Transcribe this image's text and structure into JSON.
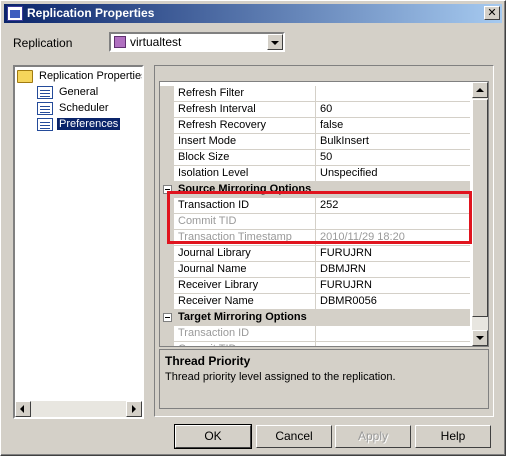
{
  "window": {
    "title": "Replication Properties"
  },
  "replication": {
    "label": "Replication",
    "selected": "virtualtest"
  },
  "tree": {
    "root": "Replication Properties",
    "items": [
      "General",
      "Scheduler",
      "Preferences"
    ],
    "selected": "Preferences"
  },
  "properties": {
    "rows": [
      {
        "type": "prop",
        "name": "Refresh Filter",
        "value": "",
        "disabled": false
      },
      {
        "type": "prop",
        "name": "Refresh Interval",
        "value": "60",
        "disabled": false
      },
      {
        "type": "prop",
        "name": "Refresh Recovery",
        "value": "false",
        "disabled": false
      },
      {
        "type": "prop",
        "name": "Insert Mode",
        "value": "BulkInsert",
        "disabled": false
      },
      {
        "type": "prop",
        "name": "Block Size",
        "value": "50",
        "disabled": false
      },
      {
        "type": "prop",
        "name": "Isolation Level",
        "value": "Unspecified",
        "disabled": false
      },
      {
        "type": "category",
        "name": "Source Mirroring Options"
      },
      {
        "type": "prop",
        "name": "Transaction ID",
        "value": "252",
        "disabled": false
      },
      {
        "type": "prop",
        "name": "Commit TID",
        "value": "",
        "disabled": true
      },
      {
        "type": "prop",
        "name": "Transaction Timestamp",
        "value": "2010/11/29 18:20",
        "disabled": true
      },
      {
        "type": "prop",
        "name": "Journal Library",
        "value": "FURUJRN",
        "disabled": false
      },
      {
        "type": "prop",
        "name": "Journal Name",
        "value": "DBMJRN",
        "disabled": false
      },
      {
        "type": "prop",
        "name": "Receiver Library",
        "value": "FURUJRN",
        "disabled": false
      },
      {
        "type": "prop",
        "name": "Receiver Name",
        "value": "DBMR0056",
        "disabled": false
      },
      {
        "type": "category",
        "name": "Target Mirroring Options"
      },
      {
        "type": "prop",
        "name": "Transaction ID",
        "value": "",
        "disabled": true
      },
      {
        "type": "prop",
        "name": "Commit TID",
        "value": "",
        "disabled": true
      }
    ]
  },
  "description": {
    "title": "Thread Priority",
    "text": "Thread priority level assigned to the replication."
  },
  "buttons": {
    "ok": "OK",
    "cancel": "Cancel",
    "apply": "Apply",
    "help": "Help"
  },
  "colors": {
    "highlight": "#e0141e",
    "titlebar": "#0a246a",
    "selection": "#0a246a"
  }
}
